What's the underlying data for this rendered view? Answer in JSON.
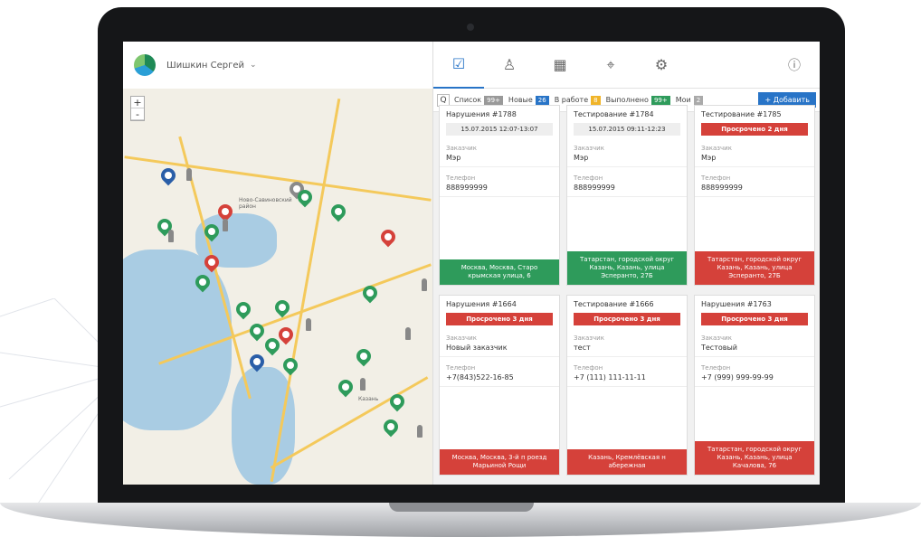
{
  "user": {
    "name": "Шишкин Сергей"
  },
  "map": {
    "zoom_in": "+",
    "zoom_out": "-",
    "labels": [
      "Ново-Савиновский район",
      "Казань"
    ]
  },
  "toolbar": {
    "search_icon": "Q",
    "filters": [
      {
        "label": "Список",
        "count": "99+",
        "color": "#999999"
      },
      {
        "label": "Новые",
        "count": "26",
        "color": "#2874c7"
      },
      {
        "label": "В работе",
        "count": "8",
        "color": "#f0b429"
      },
      {
        "label": "Выполнено",
        "count": "99+",
        "color": "#2e9b5b"
      },
      {
        "label": "Мои",
        "count": "2",
        "color": "#aaaaaa"
      }
    ],
    "add_label": "+ Добавить"
  },
  "cards": [
    {
      "title": "Нарушения #1788",
      "date": "15.07.2015 12:07-13:07",
      "client_label": "Заказчик",
      "client": "Мэр",
      "phone_label": "Телефон",
      "phone": "888999999",
      "address": "Москва, Москва, Старо крымская улица, 6",
      "status": "green"
    },
    {
      "title": "Тестирование #1784",
      "date": "15.07.2015 09:11-12:23",
      "client_label": "Заказчик",
      "client": "Мэр",
      "phone_label": "Телефон",
      "phone": "888999999",
      "address": "Татарстан, городской округ Казань, Казань, улица Эсперанто, 27Б",
      "status": "green"
    },
    {
      "title": "Тестирование #1785",
      "overdue": "Просрочено 2 дня",
      "client_label": "Заказчик",
      "client": "Мэр",
      "phone_label": "Телефон",
      "phone": "888999999",
      "address": "Татарстан, городской округ Казань, Казань, улица Эсперанто, 27Б",
      "status": "red"
    },
    {
      "title": "Нарушения #1664",
      "overdue": "Просрочено 3 дня",
      "client_label": "Заказчик",
      "client": "Новый заказчик",
      "phone_label": "Телефон",
      "phone": "+7(843)522-16-85",
      "address": "Москва, Москва, 3-й п роезд Марьиной Рощи",
      "status": "red"
    },
    {
      "title": "Тестирование #1666",
      "overdue": "Просрочено 3 дня",
      "client_label": "Заказчик",
      "client": "тест",
      "phone_label": "Телефон",
      "phone": "+7 (111) 111-11-11",
      "address": "Казань, Кремлёвская н абережная",
      "status": "red"
    },
    {
      "title": "Нарушения #1763",
      "overdue": "Просрочено 3 дня",
      "client_label": "Заказчик",
      "client": "Тестовый",
      "phone_label": "Телефон",
      "phone": "+7 (999) 999-99-99",
      "address": "Татарстан, городской округ Казань, Казань, улица Качалова, 76",
      "status": "red"
    }
  ]
}
